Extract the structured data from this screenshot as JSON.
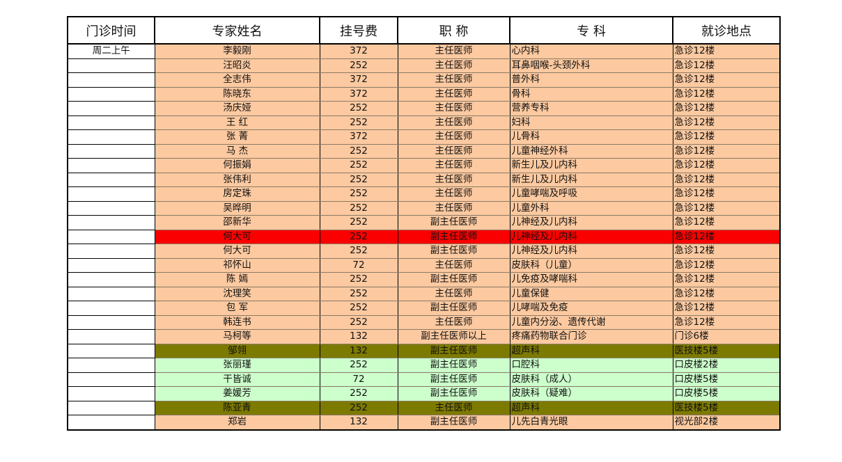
{
  "headers": [
    "门诊时间",
    "专家姓名",
    "挂号费",
    "职 称",
    "专 科",
    "就诊地点"
  ],
  "colors": {
    "peach": "#fcc9a0",
    "highlight": "#fb0000",
    "olive": "#7d7a00",
    "mint": "#ccffcc"
  },
  "rows": [
    {
      "time": "周二上午",
      "name": "李毅刚",
      "fee": "372",
      "title": "主任医师",
      "dept": "心内科",
      "loc": "急诊12楼",
      "style": "peach"
    },
    {
      "time": "",
      "name": "汪昭炎",
      "fee": "252",
      "title": "主任医师",
      "dept": "耳鼻咽喉-头颈外科",
      "loc": "急诊12楼",
      "style": "peach"
    },
    {
      "time": "",
      "name": "全志伟",
      "fee": "372",
      "title": "主任医师",
      "dept": "普外科",
      "loc": "急诊12楼",
      "style": "peach"
    },
    {
      "time": "",
      "name": "陈晓东",
      "fee": "372",
      "title": "主任医师",
      "dept": "骨科",
      "loc": "急诊12楼",
      "style": "peach"
    },
    {
      "time": "",
      "name": "汤庆娅",
      "fee": "252",
      "title": "主任医师",
      "dept": "营养专科",
      "loc": "急诊12楼",
      "style": "peach"
    },
    {
      "time": "",
      "name": "王 红",
      "fee": "252",
      "title": "主任医师",
      "dept": "妇科",
      "loc": "急诊12楼",
      "style": "peach"
    },
    {
      "time": "",
      "name": "张 菁",
      "fee": "372",
      "title": "主任医师",
      "dept": "儿骨科",
      "loc": "急诊12楼",
      "style": "peach"
    },
    {
      "time": "",
      "name": "马 杰",
      "fee": "252",
      "title": "主任医师",
      "dept": "儿童神经外科",
      "loc": "急诊12楼",
      "style": "peach"
    },
    {
      "time": "",
      "name": "何振娟",
      "fee": "252",
      "title": "主任医师",
      "dept": "新生儿及儿内科",
      "loc": "急诊12楼",
      "style": "peach"
    },
    {
      "time": "",
      "name": "张伟利",
      "fee": "252",
      "title": "主任医师",
      "dept": "新生儿及儿内科",
      "loc": "急诊12楼",
      "style": "peach"
    },
    {
      "time": "",
      "name": "房定珠",
      "fee": "252",
      "title": "主任医师",
      "dept": "儿童哮喘及呼吸",
      "loc": "急诊12楼",
      "style": "peach"
    },
    {
      "time": "",
      "name": "吴晔明",
      "fee": "252",
      "title": "主任医师",
      "dept": "儿童外科",
      "loc": "急诊12楼",
      "style": "peach"
    },
    {
      "time": "",
      "name": "邵新华",
      "fee": "252",
      "title": "副主任医师",
      "dept": "儿神经及儿内科",
      "loc": "急诊12楼",
      "style": "peach"
    },
    {
      "time": "",
      "name": "何大可",
      "fee": "252",
      "title": "副主任医师",
      "dept": "儿神经及儿内科",
      "loc": "急诊12楼",
      "style": "highlight"
    },
    {
      "time": "",
      "name": "何大可",
      "fee": "252",
      "title": "副主任医师",
      "dept": "儿神经及儿内科",
      "loc": "急诊12楼",
      "style": "peach"
    },
    {
      "time": "",
      "name": "祁怀山",
      "fee": "72",
      "title": "主任医师",
      "dept": "皮肤科（儿童）",
      "loc": "急诊12楼",
      "style": "peach"
    },
    {
      "time": "",
      "name": "陈 嫣",
      "fee": "252",
      "title": "副主任医师",
      "dept": "儿免疫及哮喘科",
      "loc": "急诊12楼",
      "style": "peach"
    },
    {
      "time": "",
      "name": "沈理笑",
      "fee": "252",
      "title": "主任医师",
      "dept": "儿童保健",
      "loc": "急诊12楼",
      "style": "peach"
    },
    {
      "time": "",
      "name": "包 军",
      "fee": "252",
      "title": "副主任医师",
      "dept": "儿哮喘及免疫",
      "loc": "急诊12楼",
      "style": "peach"
    },
    {
      "time": "",
      "name": "韩连书",
      "fee": "252",
      "title": "主任医师",
      "dept": "儿童内分泌、遗传代谢",
      "loc": "急诊12楼",
      "style": "peach"
    },
    {
      "time": "",
      "name": "马柯等",
      "fee": "132",
      "title": "副主任医师以上",
      "dept": "疼痛药物联合门诊",
      "loc": "门诊6楼",
      "style": "peach"
    },
    {
      "time": "",
      "name": "邹翎",
      "fee": "132",
      "title": "副主任医师",
      "dept": "超声科",
      "loc": "医技楼5楼",
      "style": "olive"
    },
    {
      "time": "",
      "name": "张丽瑾",
      "fee": "252",
      "title": "副主任医师",
      "dept": "口腔科",
      "loc": "口皮楼2楼",
      "style": "mint"
    },
    {
      "time": "",
      "name": "干皆诚",
      "fee": "72",
      "title": "副主任医师",
      "dept": "皮肤科（成人）",
      "loc": "口皮楼5楼",
      "style": "mint"
    },
    {
      "time": "",
      "name": "姜媛芳",
      "fee": "252",
      "title": "副主任医师",
      "dept": "皮肤科（疑难）",
      "loc": "口皮楼5楼",
      "style": "mint"
    },
    {
      "time": "",
      "name": "陈亚青",
      "fee": "252",
      "title": "主任医师",
      "dept": "超声科",
      "loc": "医技楼5楼",
      "style": "olive"
    },
    {
      "time": "",
      "name": "郑岩",
      "fee": "132",
      "title": "副主任医师",
      "dept": "儿先白青光眼",
      "loc": "视光部2楼",
      "style": "peach"
    }
  ]
}
